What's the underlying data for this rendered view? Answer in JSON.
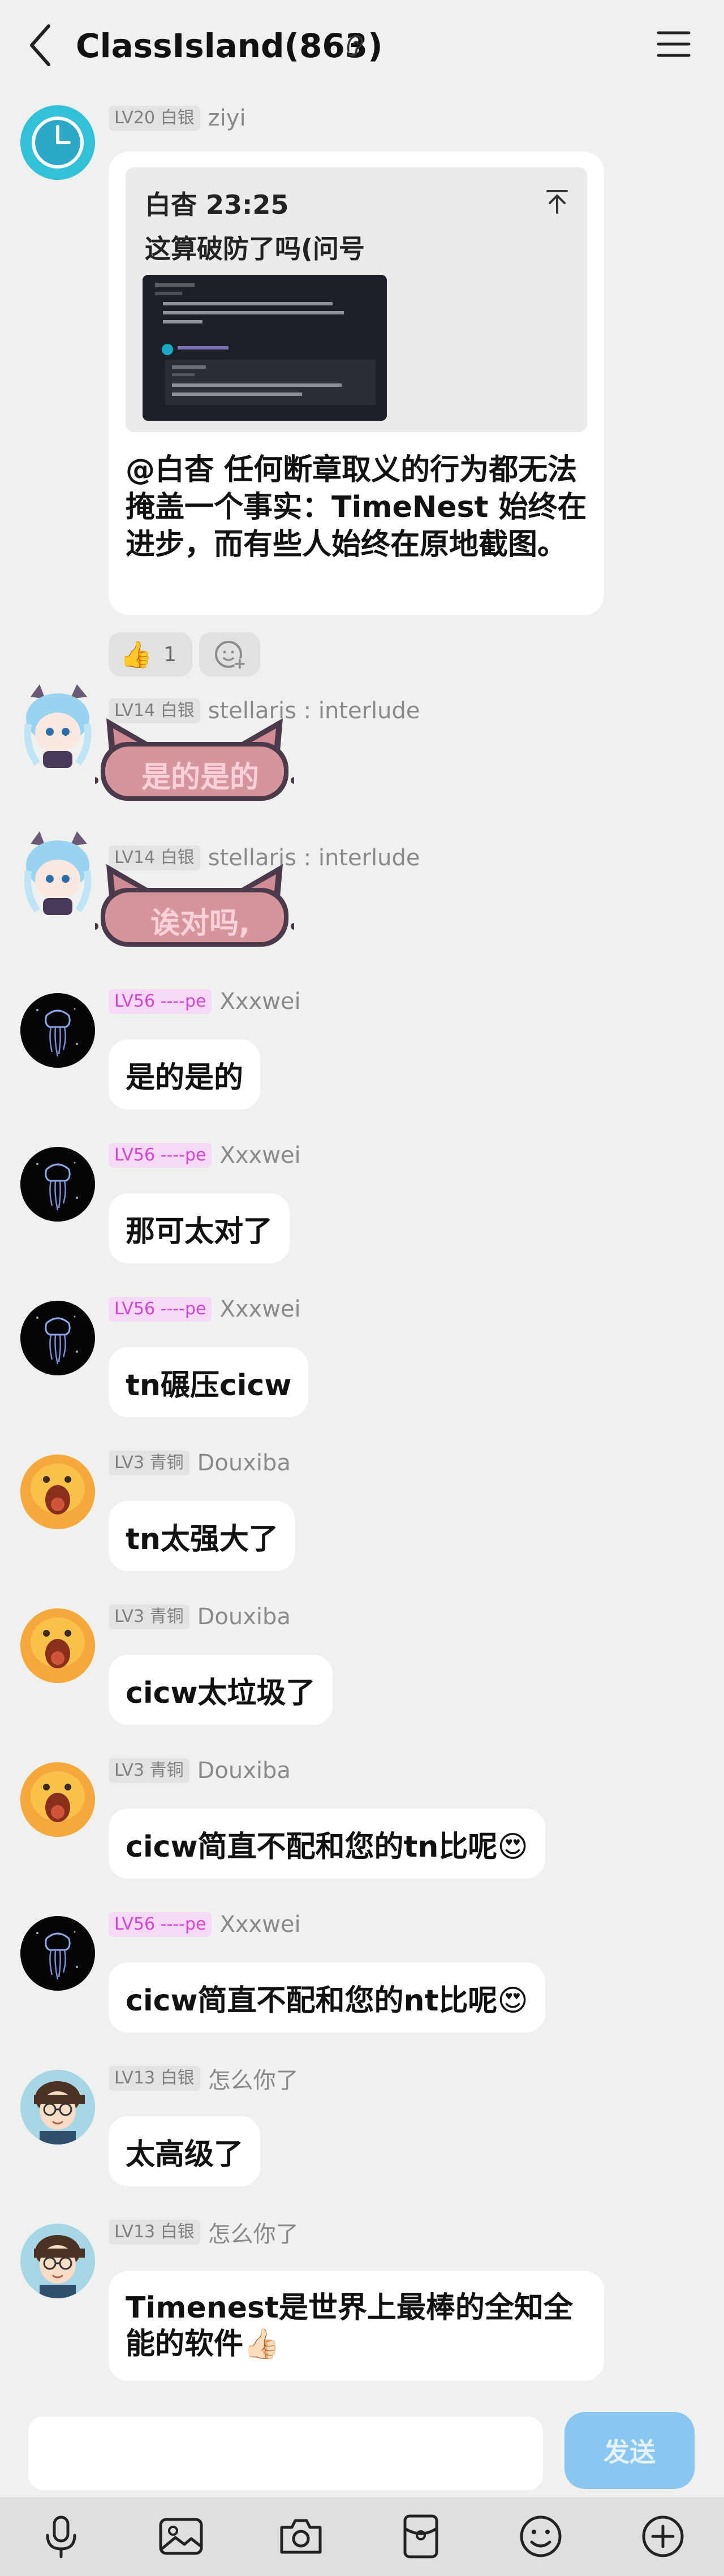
{
  "header": {
    "title": "ClassIsland(863)"
  },
  "reply_message": {
    "level": "LV20 白银",
    "name": "ziyi",
    "quote": {
      "name": "白杳 23:25",
      "text": "这算破防了吗(问号"
    },
    "text": "@白杳 任何断章取义的行为都无法掩盖一个事实：TimeNest 始终在进步，而有些人始终在原地截图。",
    "reaction": {
      "emoji": "👍",
      "count": "1"
    }
  },
  "messages": [
    {
      "level": "LV14 白银",
      "name": "stellaris : interlude",
      "text": "是的是的",
      "type": "cat"
    },
    {
      "level": "LV14 白银",
      "name": "stellaris : interlude",
      "text": "诶对吗,",
      "type": "cat"
    },
    {
      "level": "LV56 ----pe",
      "name": "Xxxwei",
      "text": "是的是的",
      "type": "plain"
    },
    {
      "level": "LV56 ----pe",
      "name": "Xxxwei",
      "text": "那可太对了",
      "type": "plain"
    },
    {
      "level": "LV56 ----pe",
      "name": "Xxxwei",
      "text": "tn碾压cicw",
      "type": "plain"
    },
    {
      "level": "LV3 青铜",
      "name": "Douxiba",
      "text": "tn太强大了",
      "type": "plain"
    },
    {
      "level": "LV3 青铜",
      "name": "Douxiba",
      "text": "cicw太垃圾了",
      "type": "plain"
    },
    {
      "level": "LV3 青铜",
      "name": "Douxiba",
      "text": "cicw简直不配和您的tn比呢😍",
      "type": "plain"
    },
    {
      "level": "LV56 ----pe",
      "name": "Xxxwei",
      "text": "cicw简直不配和您的nt比呢😍",
      "type": "plain"
    },
    {
      "level": "LV13 白银",
      "name": "怎么你了",
      "text": "太高级了",
      "type": "plain"
    },
    {
      "level": "LV13 白银",
      "name": "怎么你了",
      "text": "Timenest是世界上最棒的全知全能的软件👍🏻",
      "type": "plain"
    }
  ],
  "input": {
    "placeholder": "",
    "send_label": "发送"
  },
  "toolbar": [
    "mic-icon",
    "image-icon",
    "camera-icon",
    "red-packet-icon",
    "emoji-icon",
    "plus-icon"
  ]
}
